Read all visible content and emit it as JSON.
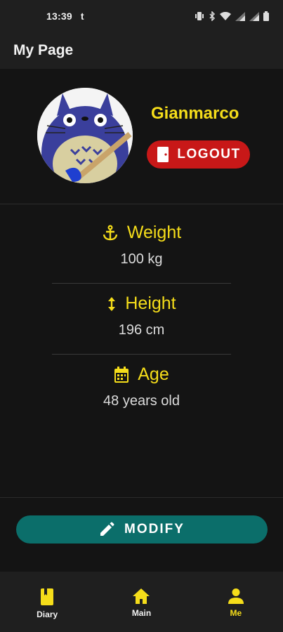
{
  "status_bar": {
    "time": "13:39",
    "extra": "t"
  },
  "app_bar": {
    "title": "My Page"
  },
  "profile": {
    "username": "Gianmarco",
    "logout_label": "LOGOUT"
  },
  "stats": [
    {
      "icon": "anchor-icon",
      "label": "Weight",
      "value": "100 kg"
    },
    {
      "icon": "up-down-arrow-icon",
      "label": "Height",
      "value": "196 cm"
    },
    {
      "icon": "calendar-icon",
      "label": "Age",
      "value": "48 years old"
    }
  ],
  "modify_label": "MODIFY",
  "bottom_nav": [
    {
      "label": "Diary",
      "icon": "book-icon",
      "active": false
    },
    {
      "label": "Main",
      "icon": "home-icon",
      "active": false
    },
    {
      "label": "Me",
      "icon": "person-icon",
      "active": true
    }
  ],
  "colors": {
    "accent": "#f5dd1a",
    "logout": "#c81818",
    "modify": "#0b6e6a",
    "background": "#141414"
  }
}
